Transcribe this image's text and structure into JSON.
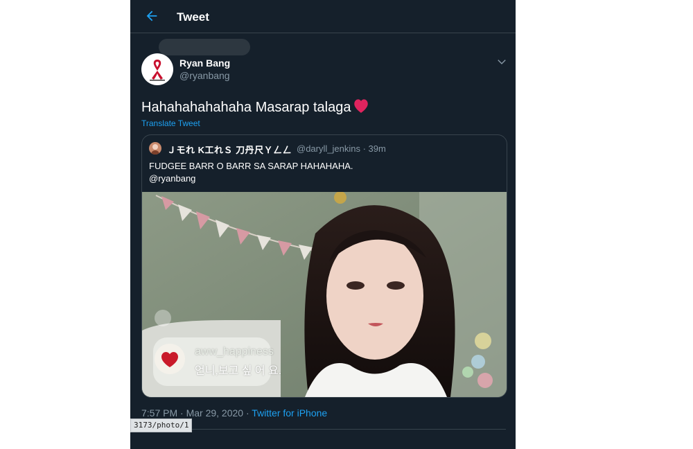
{
  "header": {
    "title": "Tweet",
    "back_icon": "arrow-left-icon"
  },
  "tweet": {
    "display_name": "Ryan Bang",
    "handle": "@ryanbang",
    "text": "Hahahahahahaha Masarap talaga",
    "emoji": "red-heart",
    "translate_label": "Translate Tweet",
    "timestamp": "7:57 PM · Mar 29, 2020 · ",
    "source": "Twitter for iPhone"
  },
  "quote": {
    "display_name": "Ｊモれ K工れＳ 刀丹尺Ｙㄥㄥ",
    "handle": "@daryll_jenkins · 39m",
    "line1": "FUDGEE BARR O BARR SA SARAP HAHAHAHA.",
    "line2": "@ryanbang",
    "media": {
      "comment_user": "aww_happiness",
      "comment_text": "언니,보고 싶 어 요."
    }
  },
  "status_url": "3173/photo/1",
  "colors": {
    "background": "#15202b",
    "accent": "#1da1f2",
    "muted": "#8899a6",
    "border": "#38444d"
  }
}
